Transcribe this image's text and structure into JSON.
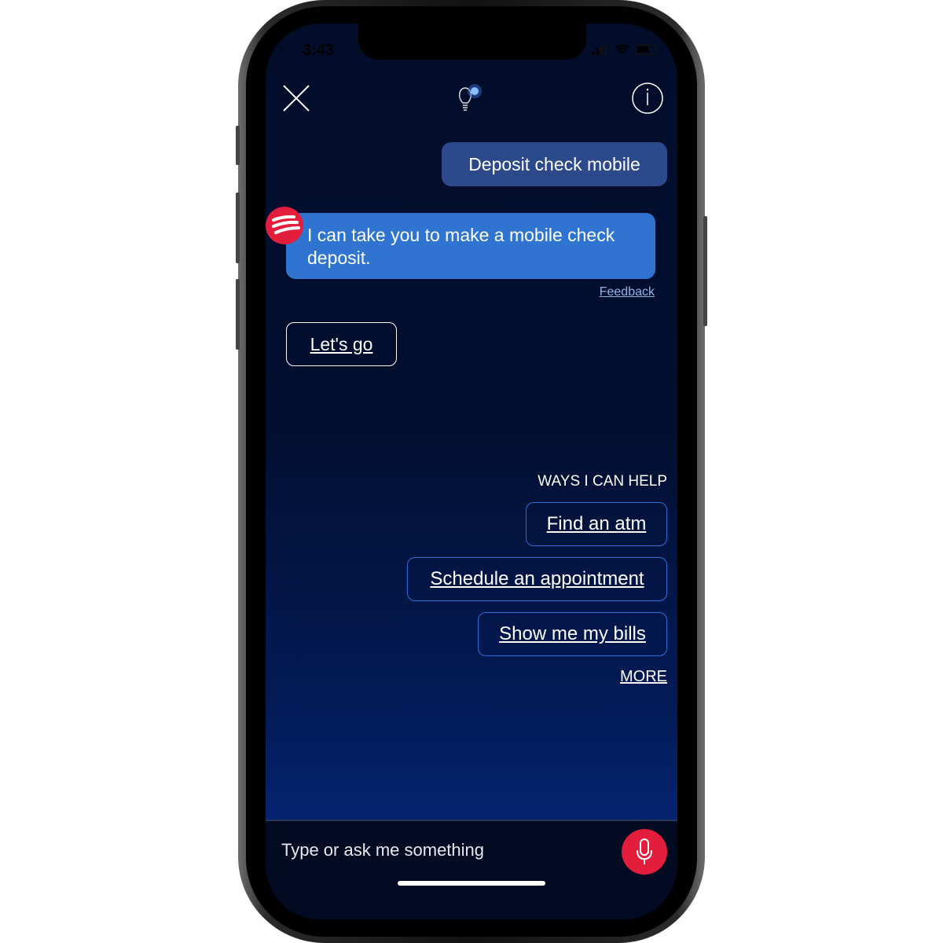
{
  "status_bar": {
    "time": "3:43"
  },
  "header": {
    "close_icon": "close-icon",
    "tips_icon": "lightbulb-icon",
    "info_icon": "info-icon"
  },
  "chat": {
    "user_message": "Deposit check mobile",
    "bot_message": "I can take you to make a mobile check deposit.",
    "feedback_label": "Feedback",
    "action_label": "Let's go"
  },
  "suggestions": {
    "heading": "WAYS I CAN HELP",
    "items": [
      {
        "label": "Find an atm"
      },
      {
        "label": "Schedule an appointment"
      },
      {
        "label": "Show me my bills"
      }
    ],
    "more_label": "MORE"
  },
  "input": {
    "placeholder": "Type or ask me something",
    "mic_icon": "microphone-icon"
  },
  "colors": {
    "accent": "#2f74d0",
    "brand_red": "#e31d3c",
    "user_bubble": "#2c4a8b",
    "background": "#020d2a"
  }
}
